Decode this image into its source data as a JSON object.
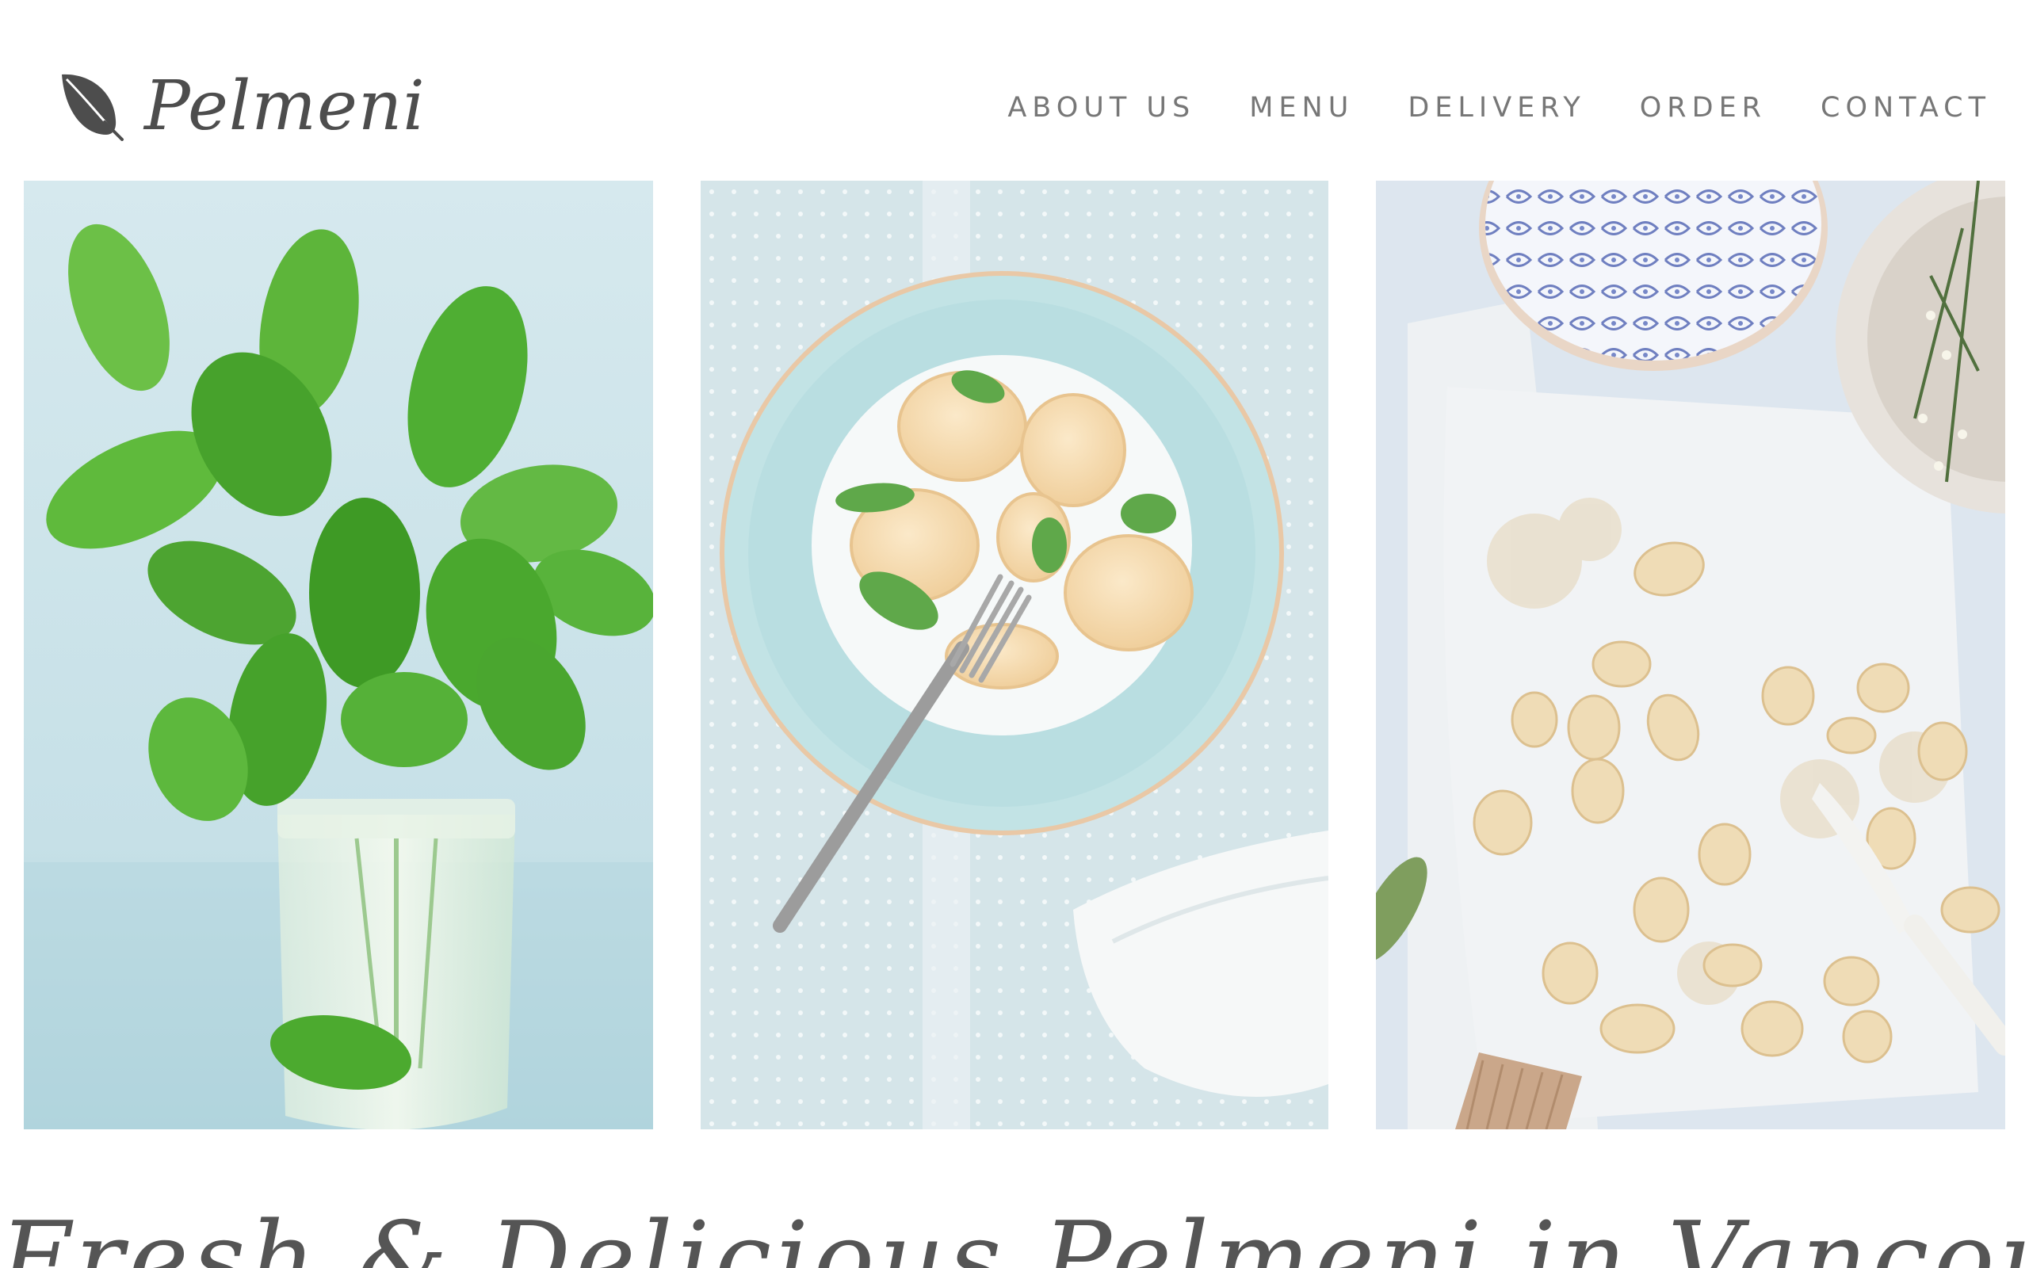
{
  "brand": {
    "name": "Pelmeni",
    "icon": "leaf-icon"
  },
  "nav": {
    "items": [
      {
        "label": "ABOUT US"
      },
      {
        "label": "MENU"
      },
      {
        "label": "DELIVERY"
      },
      {
        "label": "ORDER"
      },
      {
        "label": "CONTACT"
      }
    ]
  },
  "gallery": {
    "photos": [
      {
        "subject": "mint sprigs in a glass jar"
      },
      {
        "subject": "plate of pelmeni with mint and fork"
      },
      {
        "subject": "homemade gnocchi on parchment with flour"
      }
    ]
  },
  "hero": {
    "tagline": "Fresh & Delicious Pelmeni in Vancouver"
  },
  "colors": {
    "text": "#4d4d4d",
    "nav": "#777777",
    "photo_bg_1": "#cfe4ea",
    "photo_bg_2": "#d8e6ea",
    "photo_bg_3": "#dfe7ef"
  }
}
